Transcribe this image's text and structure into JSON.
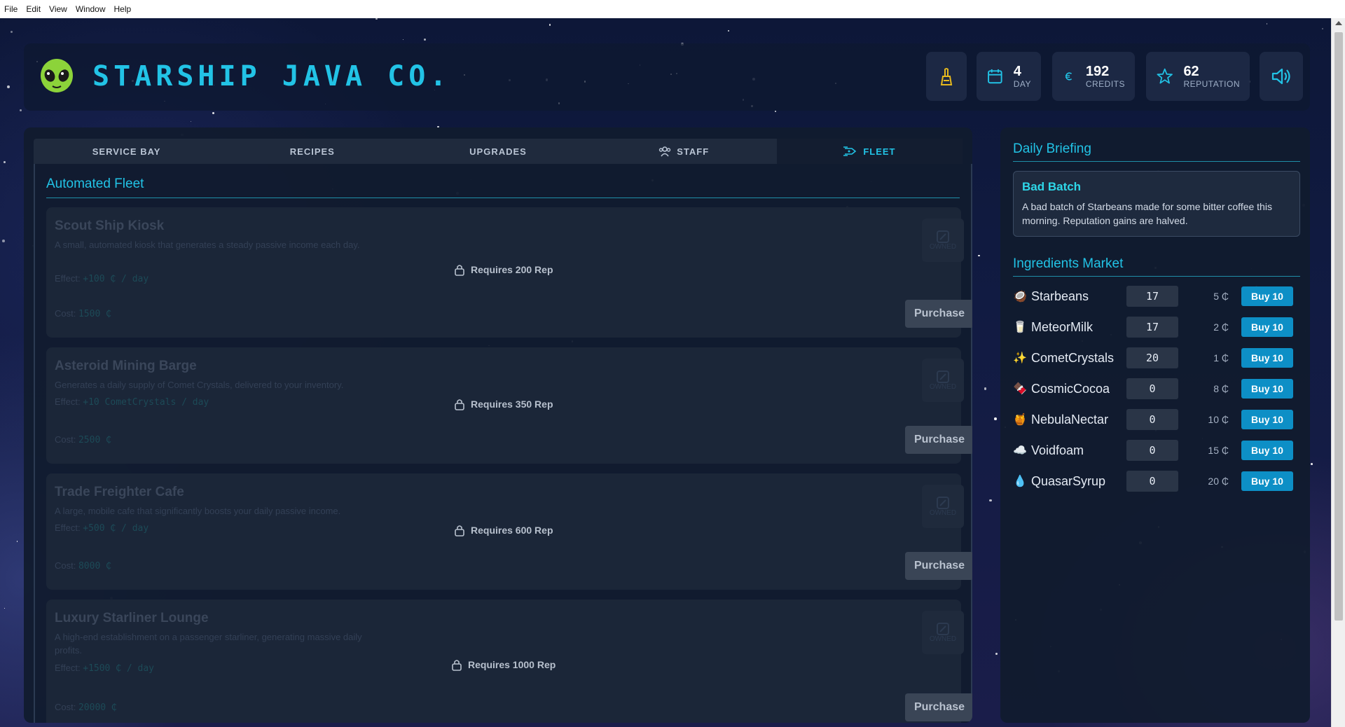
{
  "menu": [
    "File",
    "Edit",
    "View",
    "Window",
    "Help"
  ],
  "header": {
    "brand": "STARSHIP JAVA CO.",
    "day": {
      "value": "4",
      "label": "DAY"
    },
    "credits": {
      "value": "192",
      "label": "CREDITS"
    },
    "reputation": {
      "value": "62",
      "label": "REPUTATION"
    }
  },
  "tabs": [
    {
      "label": "SERVICE BAY"
    },
    {
      "label": "RECIPES"
    },
    {
      "label": "UPGRADES"
    },
    {
      "label": "STAFF"
    },
    {
      "label": "FLEET"
    }
  ],
  "fleet": {
    "title": "Automated Fleet",
    "owned_label": "OWNED",
    "effect_label": "Effect:",
    "cost_label": "Cost:",
    "purchase_label": "Purchase",
    "items": [
      {
        "name": "Scout Ship Kiosk",
        "desc": "A small, automated kiosk that generates a steady passive income each day.",
        "effect": "+100 ₵ / day",
        "cost": "1500 ₵",
        "requirement": "Requires 200 Rep"
      },
      {
        "name": "Asteroid Mining Barge",
        "desc": "Generates a daily supply of Comet Crystals, delivered to your inventory.",
        "effect": "+10 CometCrystals / day",
        "cost": "2500 ₵",
        "requirement": "Requires 350 Rep"
      },
      {
        "name": "Trade Freighter Cafe",
        "desc": "A large, mobile cafe that significantly boosts your daily passive income.",
        "effect": "+500 ₵ / day",
        "cost": "8000 ₵",
        "requirement": "Requires 600 Rep"
      },
      {
        "name": "Luxury Starliner Lounge",
        "desc": "A high-end establishment on a passenger starliner, generating massive daily profits.",
        "effect": "+1500 ₵ / day",
        "cost": "20000 ₵",
        "requirement": "Requires 1000 Rep"
      }
    ]
  },
  "briefing": {
    "title": "Daily Briefing",
    "event_title": "Bad Batch",
    "event_text": "A bad batch of Starbeans made for some bitter coffee this morning. Reputation gains are halved."
  },
  "market": {
    "title": "Ingredients Market",
    "buy_label": "Buy 10",
    "items": [
      {
        "emoji": "🥥",
        "name": "Starbeans",
        "qty": "17",
        "price": "5 ₵"
      },
      {
        "emoji": "🥛",
        "name": "MeteorMilk",
        "qty": "17",
        "price": "2 ₵"
      },
      {
        "emoji": "✨",
        "name": "CometCrystals",
        "qty": "20",
        "price": "1 ₵"
      },
      {
        "emoji": "🍫",
        "name": "CosmicCocoa",
        "qty": "0",
        "price": "8 ₵"
      },
      {
        "emoji": "🍯",
        "name": "NebulaNectar",
        "qty": "0",
        "price": "10 ₵"
      },
      {
        "emoji": "☁️",
        "name": "Voidfoam",
        "qty": "0",
        "price": "15 ₵"
      },
      {
        "emoji": "💧",
        "name": "QuasarSyrup",
        "qty": "0",
        "price": "20 ₵"
      }
    ]
  }
}
